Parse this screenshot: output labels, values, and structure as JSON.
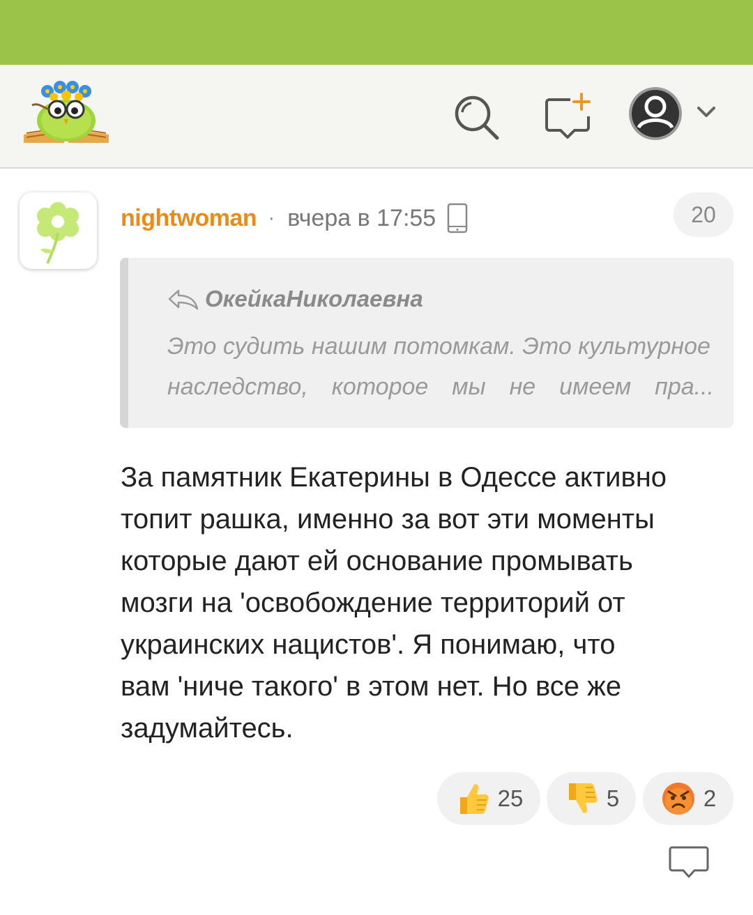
{
  "header": {
    "logo_name": "site-logo",
    "icons": [
      "search-icon",
      "add-comment-icon",
      "user-avatar-icon",
      "chevron-down-icon"
    ]
  },
  "colors": {
    "status_bar": "#9bc34a",
    "username": "#ec8a16",
    "header_bg": "#f5f5f2"
  },
  "comment": {
    "username": "nightwoman",
    "separator": "·",
    "time": "вчера в 17:55",
    "device_icon": "mobile-phone-icon",
    "count": "20",
    "quote": {
      "author": "ОкейкаНиколаевна",
      "line1": "Это судить нашим потомкам. Это культурное",
      "line2_words": [
        "наследство,",
        "которое",
        "мы",
        "не",
        "имеем",
        "пра..."
      ]
    },
    "body_lines": [
      "За памятник Екатерины в Одессе активно",
      "топит рашка, именно за вот эти моменты",
      "которые дают ей основание промывать",
      "мозги на 'освобождение территорий от",
      "украинских нацистов'. Я понимаю, что",
      "вам 'ниче такого' в этом нет. Но все же",
      "задумайтесь."
    ],
    "reactions": {
      "like": "25",
      "dislike": "5",
      "angry": "2"
    }
  }
}
